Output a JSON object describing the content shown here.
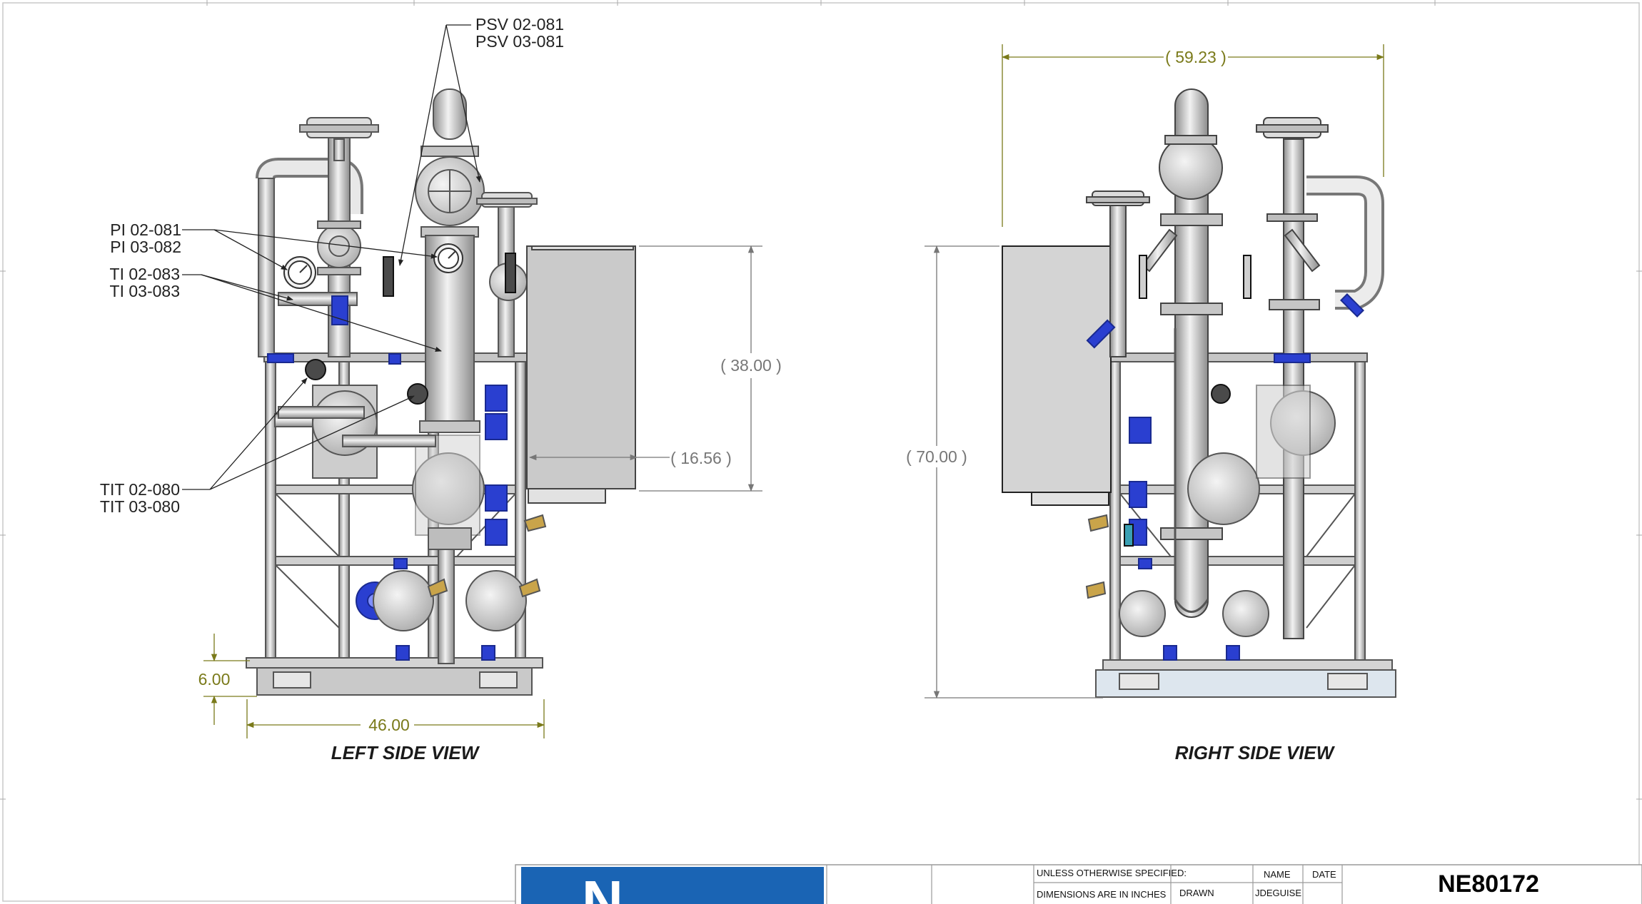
{
  "callouts": {
    "psv": [
      "PSV 02-081",
      "PSV 03-081"
    ],
    "pi": [
      "PI 02-081",
      "PI 03-082"
    ],
    "ti": [
      "TI 02-083",
      "TI 03-083"
    ],
    "tit": [
      "TIT 02-080",
      "TIT 03-080"
    ]
  },
  "dimensions": {
    "overall_width_right": "59.23",
    "panel_height_left": "38.00",
    "panel_depth_left": "16.56",
    "overall_height_right": "70.00",
    "base_height_left": "6.00",
    "base_width_left": "46.00"
  },
  "views": {
    "left": "LEFT SIDE VIEW",
    "right": "RIGHT SIDE VIEW"
  },
  "title_block": {
    "unless_specified": "UNLESS OTHERWISE SPECIFIED:",
    "dimensions_note": "DIMENSIONS ARE IN INCHES",
    "name_header": "NAME",
    "date_header": "DATE",
    "drawn_label": "DRAWN",
    "drawn_name": "JDEGUISE",
    "doc_number": "NE80172"
  },
  "colors": {
    "dimension_olive": "#7a7a1a",
    "valve_blue": "#2a3fd0",
    "logo_blue": "#1a64b4"
  }
}
